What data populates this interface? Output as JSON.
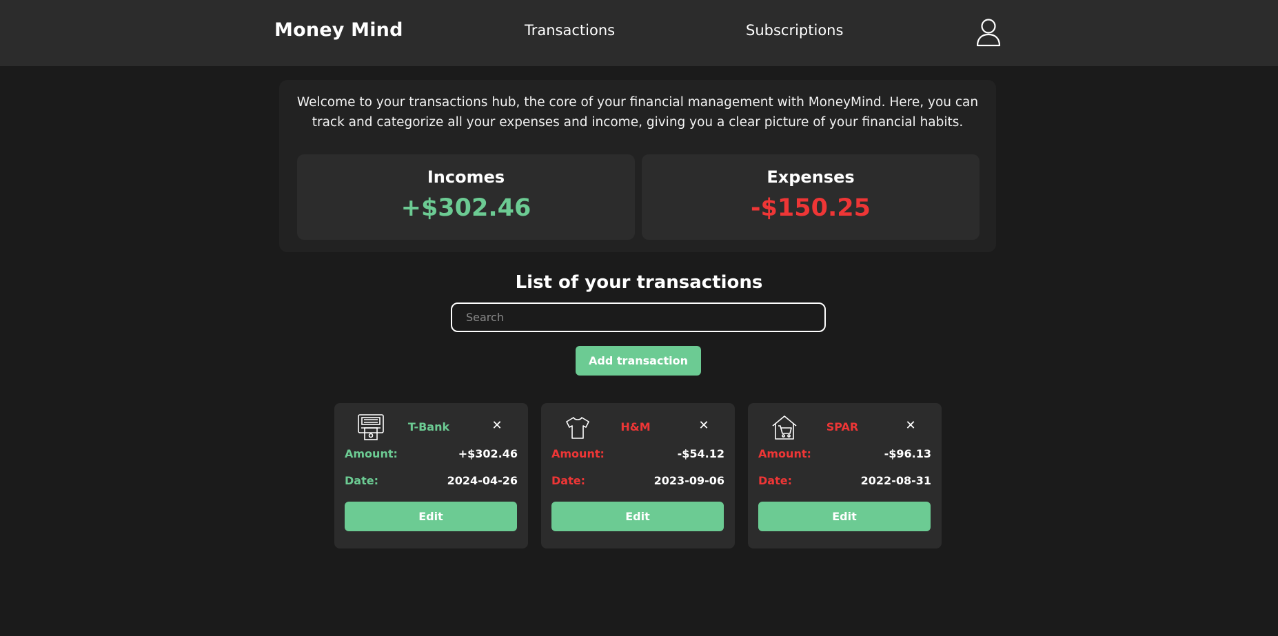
{
  "header": {
    "brand": "Money Mind",
    "nav": [
      {
        "label": "Transactions"
      },
      {
        "label": "Subscriptions"
      }
    ],
    "profile_icon": "user-icon"
  },
  "intro": {
    "text": "Welcome to your transactions hub, the core of your financial management with MoneyMind. Here, you can track and categorize all your expenses and income, giving you a clear picture of your financial habits."
  },
  "summary": {
    "incomes": {
      "title": "Incomes",
      "value": "+$302.46"
    },
    "expenses": {
      "title": "Expenses",
      "value": "-$150.25"
    }
  },
  "transactions": {
    "title": "List of your transactions",
    "search_placeholder": "Search",
    "add_label": "Add transaction",
    "items": [
      {
        "name": "T-Bank",
        "icon": "atm-icon",
        "type": "income",
        "amount_label": "Amount:",
        "amount": "+$302.46",
        "date_label": "Date:",
        "date": "2024-04-26",
        "edit_label": "Edit",
        "close": "✕"
      },
      {
        "name": "H&M",
        "icon": "tshirt-icon",
        "type": "expense",
        "amount_label": "Amount:",
        "amount": "-$54.12",
        "date_label": "Date:",
        "date": "2023-09-06",
        "edit_label": "Edit",
        "close": "✕"
      },
      {
        "name": "SPAR",
        "icon": "store-cart-icon",
        "type": "expense",
        "amount_label": "Amount:",
        "amount": "-$96.13",
        "date_label": "Date:",
        "date": "2022-08-31",
        "edit_label": "Edit",
        "close": "✕"
      }
    ]
  },
  "colors": {
    "background": "#1b1b1b",
    "surface": "#2c2c2c",
    "income": "#6ccb93",
    "expense": "#ee3636",
    "button": "#6ccb93"
  }
}
